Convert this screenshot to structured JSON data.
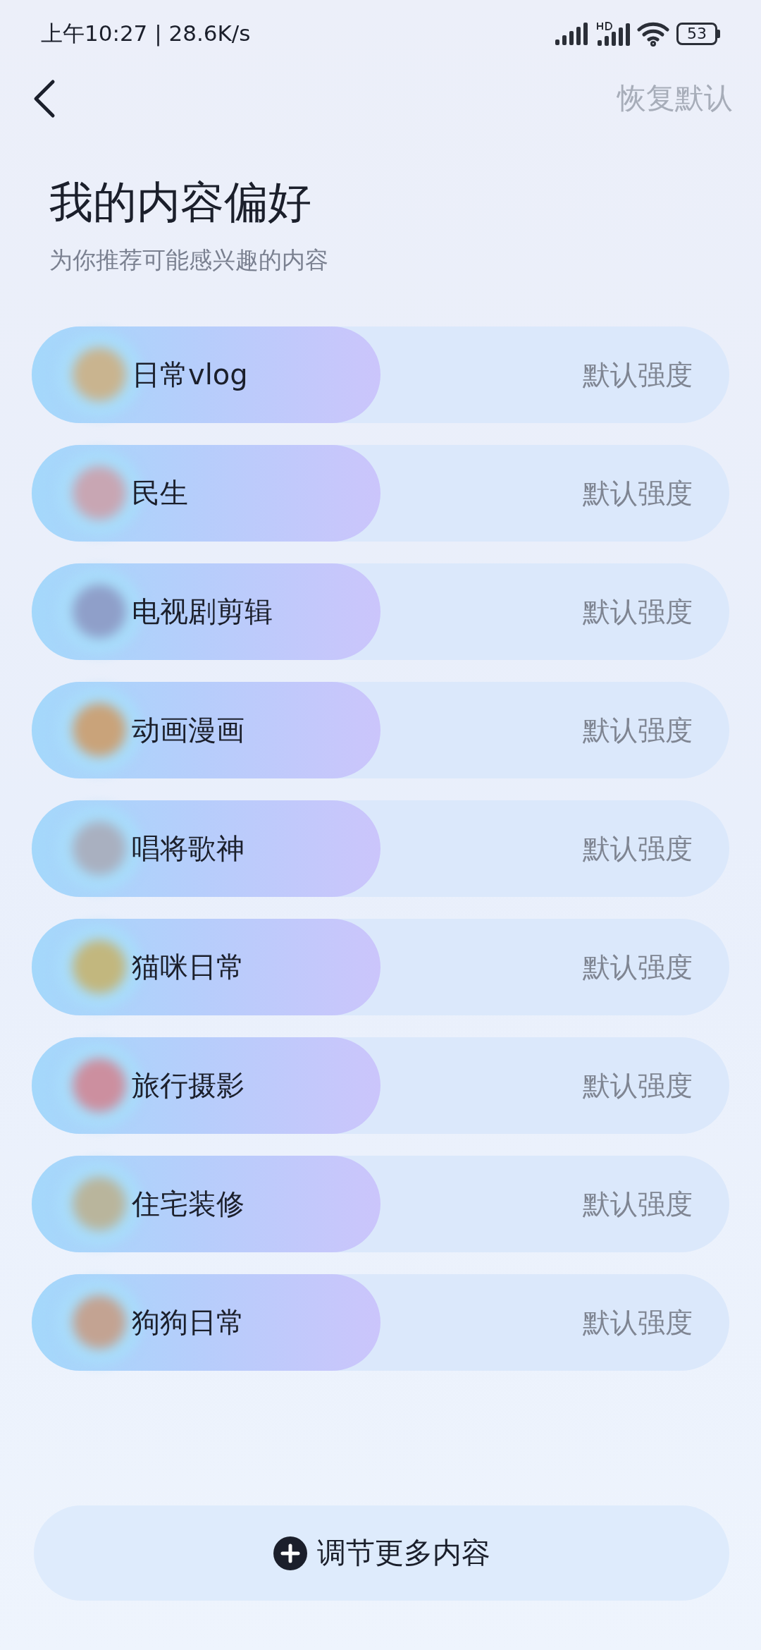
{
  "status_bar": {
    "time": "上午10:27 | 28.6K/s",
    "battery": "53"
  },
  "header": {
    "reset": "恢复默认"
  },
  "title": "我的内容偏好",
  "subtitle": "为你推荐可能感兴趣的内容",
  "preferences": [
    {
      "name": "日常vlog",
      "level": 0.5,
      "reading": "默认强度",
      "color": "#c9b48f"
    },
    {
      "name": "民生",
      "level": 0.5,
      "reading": "默认强度",
      "color": "#c8a6b3"
    },
    {
      "name": "电视剧剪辑",
      "level": 0.5,
      "reading": "默认强度",
      "color": "#8f9fc9"
    },
    {
      "name": "动画漫画",
      "level": 0.5,
      "reading": "默认强度",
      "color": "#c9a37a"
    },
    {
      "name": "唱将歌神",
      "level": 0.5,
      "reading": "默认强度",
      "color": "#a9b0c0"
    },
    {
      "name": "猫咪日常",
      "level": 0.5,
      "reading": "默认强度",
      "color": "#c2b77e"
    },
    {
      "name": "旅行摄影",
      "level": 0.5,
      "reading": "默认强度",
      "color": "#cc8f9f"
    },
    {
      "name": "住宅装修",
      "level": 0.5,
      "reading": "默认强度",
      "color": "#b9b59c"
    },
    {
      "name": "狗狗日常",
      "level": 0.5,
      "reading": "默认强度",
      "color": "#c3a392"
    }
  ],
  "more_button": "调节更多内容"
}
